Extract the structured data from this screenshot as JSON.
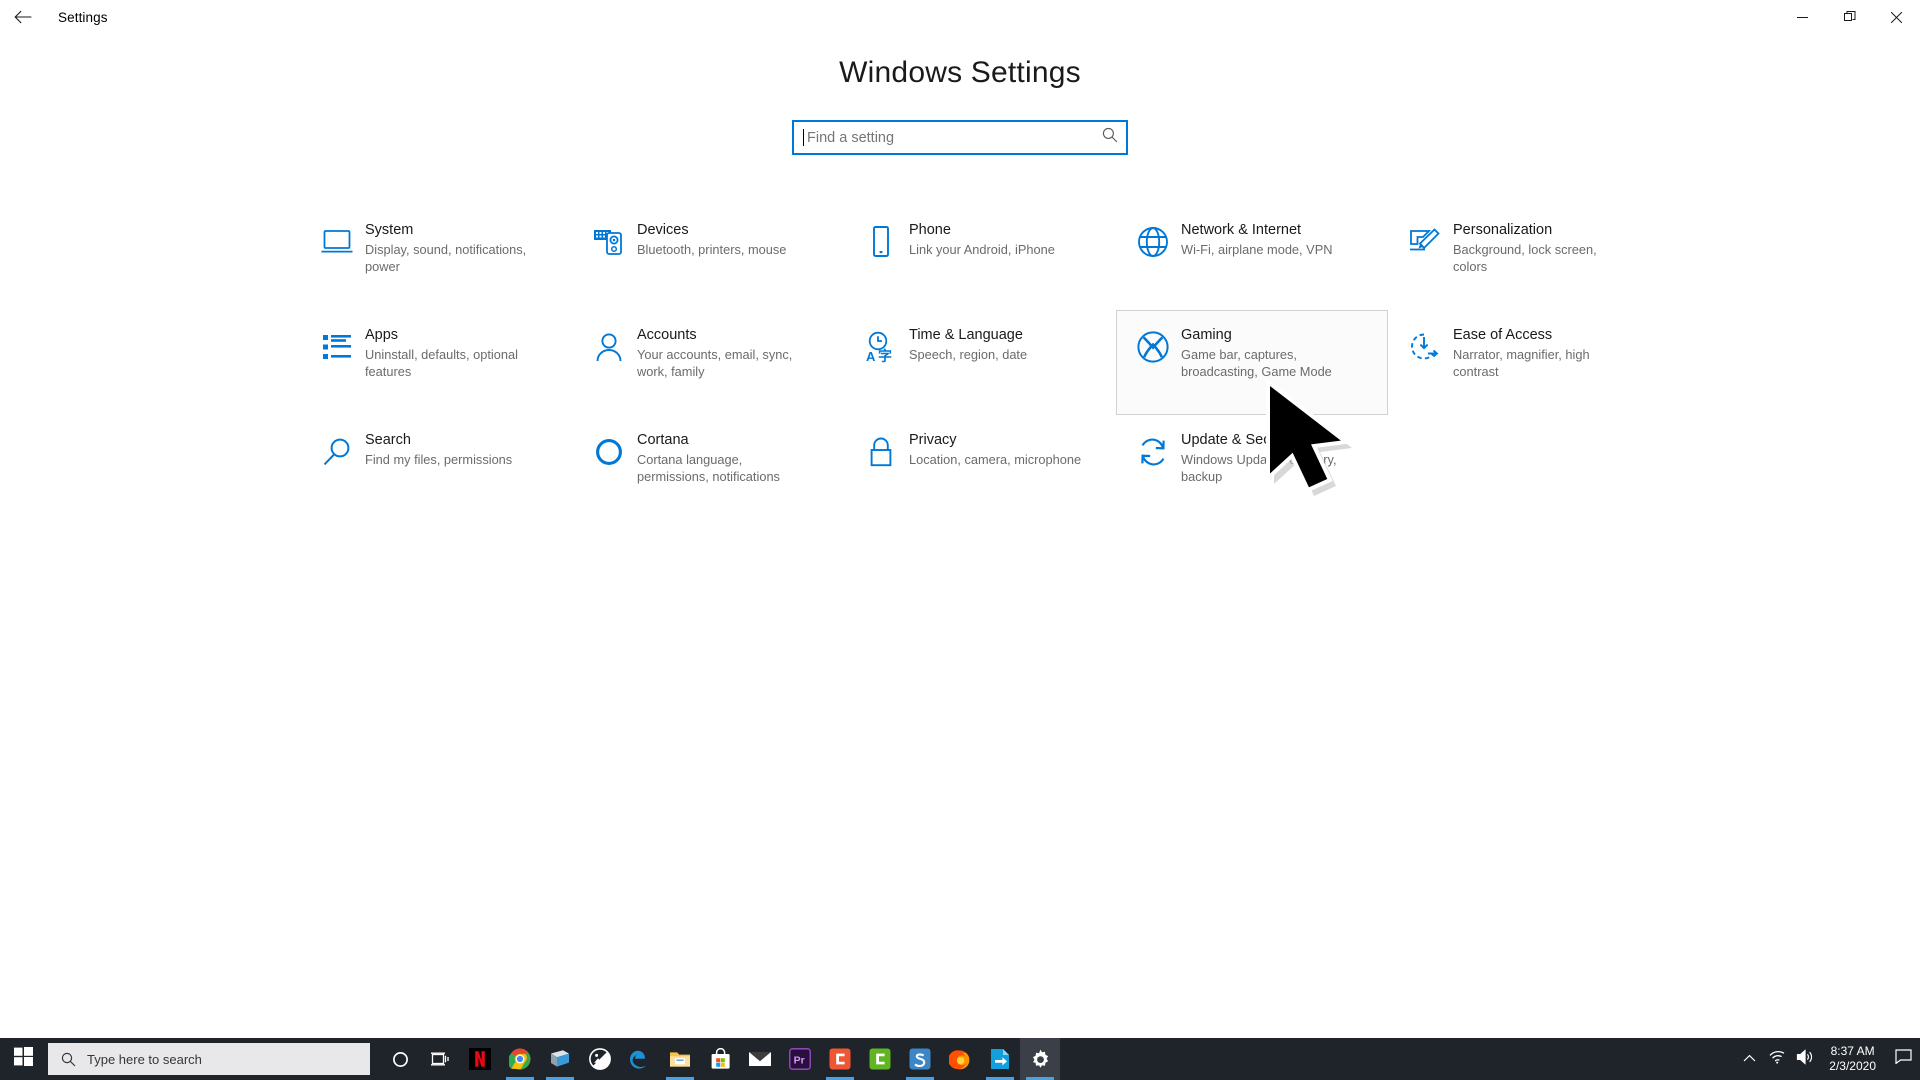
{
  "window": {
    "title": "Settings",
    "back_icon": "back-arrow-icon",
    "controls": [
      {
        "name": "minimize-button",
        "icon": "minimize-icon"
      },
      {
        "name": "restore-button",
        "icon": "restore-icon"
      },
      {
        "name": "close-button",
        "icon": "close-icon"
      }
    ]
  },
  "page": {
    "heading": "Windows Settings"
  },
  "search": {
    "placeholder": "Find a setting",
    "value": "",
    "icon": "search-icon"
  },
  "tiles": [
    {
      "icon": "monitor-icon",
      "title": "System",
      "sub": "Display, sound, notifications, power",
      "hover": false
    },
    {
      "icon": "devices-icon",
      "title": "Devices",
      "sub": "Bluetooth, printers, mouse",
      "hover": false
    },
    {
      "icon": "phone-icon",
      "title": "Phone",
      "sub": "Link your Android, iPhone",
      "hover": false
    },
    {
      "icon": "globe-icon",
      "title": "Network & Internet",
      "sub": "Wi-Fi, airplane mode, VPN",
      "hover": false
    },
    {
      "icon": "paintbrush-icon",
      "title": "Personalization",
      "sub": "Background, lock screen, colors",
      "hover": false
    },
    {
      "icon": "applist-icon",
      "title": "Apps",
      "sub": "Uninstall, defaults, optional features",
      "hover": false
    },
    {
      "icon": "person-icon",
      "title": "Accounts",
      "sub": "Your accounts, email, sync, work, family",
      "hover": false
    },
    {
      "icon": "clock-language-icon",
      "title": "Time & Language",
      "sub": "Speech, region, date",
      "hover": false
    },
    {
      "icon": "xbox-icon",
      "title": "Gaming",
      "sub": "Game bar, captures, broadcasting, Game Mode",
      "hover": true
    },
    {
      "icon": "accessibility-icon",
      "title": "Ease of Access",
      "sub": "Narrator, magnifier, high contrast",
      "hover": false
    },
    {
      "icon": "magnifier-icon",
      "title": "Search",
      "sub": "Find my files, permissions",
      "hover": false
    },
    {
      "icon": "circle-icon",
      "title": "Cortana",
      "sub": "Cortana language, permissions, notifications",
      "hover": false
    },
    {
      "icon": "lock-icon",
      "title": "Privacy",
      "sub": "Location, camera, microphone",
      "hover": false
    },
    {
      "icon": "refresh-icon",
      "title": "Update & Security",
      "sub": "Windows Update, recovery, backup",
      "hover": false
    }
  ],
  "taskbar": {
    "start_icon": "windows-logo-icon",
    "search": {
      "placeholder": "Type here to search",
      "icon": "search-icon"
    },
    "items": [
      {
        "name": "cortana-button",
        "icon": "cortana-circle-icon",
        "running": false,
        "active": false
      },
      {
        "name": "task-view-button",
        "icon": "task-view-icon",
        "running": false,
        "active": false
      },
      {
        "name": "netflix-button",
        "icon": "netflix-icon",
        "running": false,
        "active": false
      },
      {
        "name": "chrome-button",
        "icon": "chrome-icon",
        "running": true,
        "active": false
      },
      {
        "name": "sticky-notes-button",
        "icon": "sticky-notes-icon",
        "running": true,
        "active": false
      },
      {
        "name": "photos-button",
        "icon": "photos-icon",
        "running": false,
        "active": false
      },
      {
        "name": "edge-button",
        "icon": "edge-icon",
        "running": false,
        "active": false
      },
      {
        "name": "file-explorer-button",
        "icon": "folder-icon",
        "running": true,
        "active": false
      },
      {
        "name": "store-button",
        "icon": "store-bag-icon",
        "running": false,
        "active": false
      },
      {
        "name": "mail-button",
        "icon": "envelope-icon",
        "running": false,
        "active": false
      },
      {
        "name": "premiere-button",
        "icon": "premiere-pro-icon",
        "running": false,
        "active": false
      },
      {
        "name": "camtasia-button",
        "icon": "camtasia-icon",
        "running": true,
        "active": false
      },
      {
        "name": "camtasia-green-button",
        "icon": "camtasia-green-icon",
        "running": false,
        "active": false
      },
      {
        "name": "snagit-button",
        "icon": "snagit-icon",
        "running": true,
        "active": false
      },
      {
        "name": "firefox-button",
        "icon": "firefox-icon",
        "running": false,
        "active": false
      },
      {
        "name": "transfer-button",
        "icon": "blue-arrow-icon",
        "running": true,
        "active": false
      },
      {
        "name": "settings-button",
        "icon": "gear-icon",
        "running": true,
        "active": true
      }
    ],
    "tray": {
      "overflow_icon": "chevron-up-icon",
      "network_icon": "wifi-icon",
      "volume_icon": "speaker-icon",
      "time": "8:37 AM",
      "date": "2/3/2020",
      "action_center_icon": "action-center-icon"
    }
  },
  "cursor": {
    "icon": "mouse-pointer-icon"
  }
}
